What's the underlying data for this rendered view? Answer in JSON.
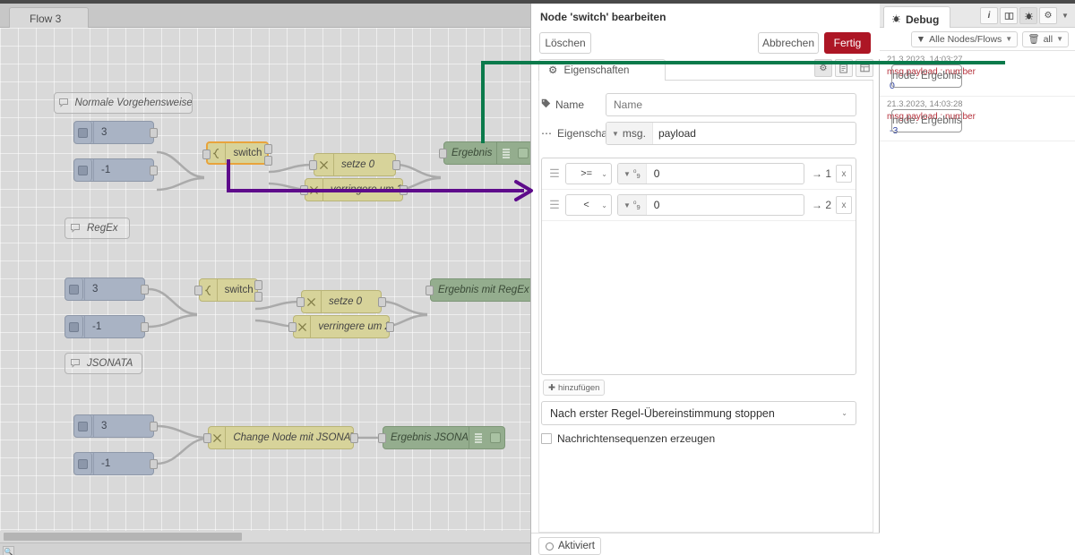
{
  "workspace": {
    "tab_label": "Flow 3",
    "comments": [
      {
        "label": "Normale Vorgehensweise",
        "icon": "comment-icon"
      },
      {
        "label": "RegEx",
        "icon": "comment-icon"
      },
      {
        "label": "JSONATA",
        "icon": "comment-icon"
      }
    ],
    "nodes": {
      "inject_3": "3",
      "inject_minus1": "-1",
      "switch": "switch",
      "set0": "setze 0",
      "decrease2": "verringere um 2",
      "result": "Ergebnis",
      "result_regex": "Ergebnis mit RegEx",
      "change_jsonata": "Change Node mit JSONATA",
      "result_jsonata": "Ergebnis JSONATA"
    },
    "colors": {
      "inject": "#a9b3c4",
      "function": "#d7d39a",
      "debug": "#94ad8e",
      "selected_outline": "#e8a33c",
      "annotation_green": "#0b7a4b",
      "annotation_purple": "#5e0b8b"
    }
  },
  "dialog": {
    "title": "Node 'switch' bearbeiten",
    "delete_label": "Löschen",
    "cancel_label": "Abbrechen",
    "done_label": "Fertig",
    "tab_label": "Eigenschaften",
    "tab_icon": "gear-icon",
    "tab_icons": [
      "gear-icon",
      "copy-icon",
      "layout-icon"
    ],
    "name_label": "Name",
    "name_placeholder": "Name",
    "name_value": "",
    "property_label": "Eigenschaft",
    "property_prefix": "msg.",
    "property_value": "payload",
    "rules": [
      {
        "operator": ">=",
        "value": "0",
        "output": "1",
        "type_icon": "number-icon",
        "remove_label": "x"
      },
      {
        "operator": "<",
        "value": "0",
        "output": "2",
        "type_icon": "number-icon",
        "remove_label": "x"
      }
    ],
    "add_rule_label": "hinzufügen",
    "stop_mode": "Nach erster Regel-Übereinstimmung stoppen",
    "recreate_sequences_label": "Nachrichtensequenzen erzeugen",
    "recreate_sequences_checked": false,
    "enabled_label": "Aktiviert",
    "done_color": "#ad1625"
  },
  "sidebar": {
    "tab_label": "Debug",
    "tab_icon": "bug-icon",
    "icons": [
      "info-icon",
      "book-icon",
      "bug-icon",
      "gear-icon",
      "chevron-down-icon"
    ],
    "filter_label": "Alle Nodes/Flows",
    "filter_icon": "filter-icon",
    "clear_label": "all",
    "clear_icon": "trash-icon",
    "messages": [
      {
        "timestamp": "21.3.2023, 14:03:27",
        "node": "node: Ergebnis",
        "property": "msg.payload : number",
        "value": "0"
      },
      {
        "timestamp": "21.3.2023, 14:03:28",
        "node": "node: Ergebnis",
        "property": "msg.payload : number",
        "value": "-3"
      }
    ]
  }
}
